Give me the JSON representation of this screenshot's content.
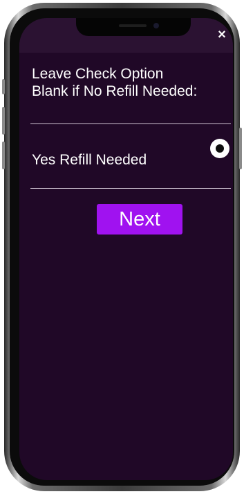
{
  "dialog": {
    "close_label": "×",
    "instruction": "Leave Check Option\nBlank if No Refill Needed:",
    "option": {
      "label": "Yes Refill Needed",
      "selected": true
    },
    "next_label": "Next"
  },
  "colors": {
    "screen_background": "#200827",
    "header_background": "#2b1232",
    "button_accent": "#a012f0",
    "text": "#ffffff"
  },
  "icons": {
    "close": "close-icon",
    "radio": "radio-selected-icon"
  }
}
